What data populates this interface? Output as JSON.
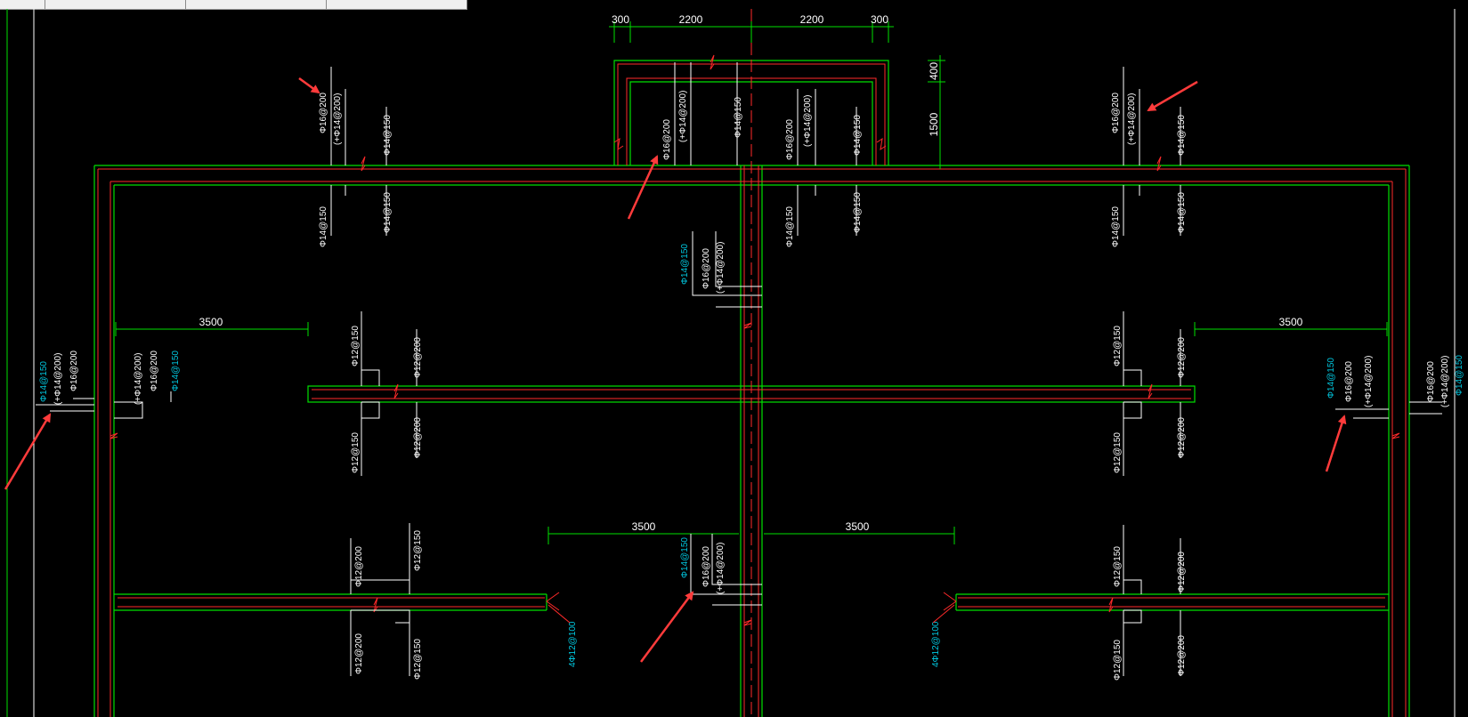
{
  "tabs": [
    "",
    "",
    "",
    ""
  ],
  "colors": {
    "background": "#000000",
    "wall_outline": "#00e000",
    "rebar": "#ff2a2a",
    "dimension": "#00e000",
    "label_white": "#ffffff",
    "label_cyan": "#00c8e0",
    "arrow": "#ff3b3b"
  },
  "dimensions": {
    "top_300_left": "300",
    "top_2200_left": "2200",
    "top_2200_right": "2200",
    "top_300_right": "300",
    "right_400": "400",
    "right_1500": "1500",
    "span_left_mid": "3500",
    "span_right_mid": "3500",
    "span_center_left": "3500",
    "span_center_right": "3500"
  },
  "labels": {
    "top_left_a": "Φ16@200",
    "top_left_b": "(+Φ14@200)",
    "top_left_c": "Φ14@150",
    "top_left_d": "Φ14@150",
    "top_left_e": "Φ14@150",
    "pit_a": "Φ16@200",
    "pit_b": "(+Φ14@200)",
    "pit_c": "Φ14@150",
    "pit_d": "Φ16@200",
    "pit_e": "(+Φ14@200)",
    "pit_f": "Φ14@150",
    "pit_g": "Φ14@150",
    "pit_h": "Φ14@150",
    "top_right_a": "Φ16@200",
    "top_right_b": "(+Φ14@200)",
    "top_right_c": "Φ14@150",
    "top_right_d": "Φ14@150",
    "top_right_e": "Φ14@150",
    "center_up_cyan": "Φ14@150",
    "center_up_a": "Φ16@200",
    "center_up_b": "(+Φ14@200)",
    "left_out_cyan": "Φ14@150",
    "left_out_a": "(+Φ14@200)",
    "left_out_b": "Φ16@200",
    "left_in_a": "(+Φ14@200)",
    "left_in_b": "Φ16@200",
    "left_in_cyan": "Φ14@150",
    "mid_l_a": "Φ12@150",
    "mid_l_b": "Φ12@200",
    "mid_l_c": "Φ12@150",
    "mid_l_d": "Φ12@200",
    "mid_r_a": "Φ12@150",
    "mid_r_b": "Φ12@200",
    "mid_r_c": "Φ12@150",
    "mid_r_d": "Φ12@200",
    "right_in_cyan": "Φ14@150",
    "right_in_a": "Φ16@200",
    "right_in_b": "(+Φ14@200)",
    "right_out_a": "Φ16@200",
    "right_out_b": "(+Φ14@200)",
    "right_out_cyan": "Φ14@150",
    "low_l_a": "Φ12@200",
    "low_l_b": "Φ12@150",
    "low_l_c": "Φ12@200",
    "low_l_d": "Φ12@150",
    "low_center_cyan": "Φ14@150",
    "low_center_a": "Φ16@200",
    "low_center_b": "(+Φ14@200)",
    "low_r_a": "Φ12@150",
    "low_r_b": "Φ12@200",
    "low_r_c": "Φ12@150",
    "low_r_d": "Φ12@200",
    "end_left_cyan": "4Φ12@100",
    "end_right_cyan": "4Φ12@100"
  }
}
